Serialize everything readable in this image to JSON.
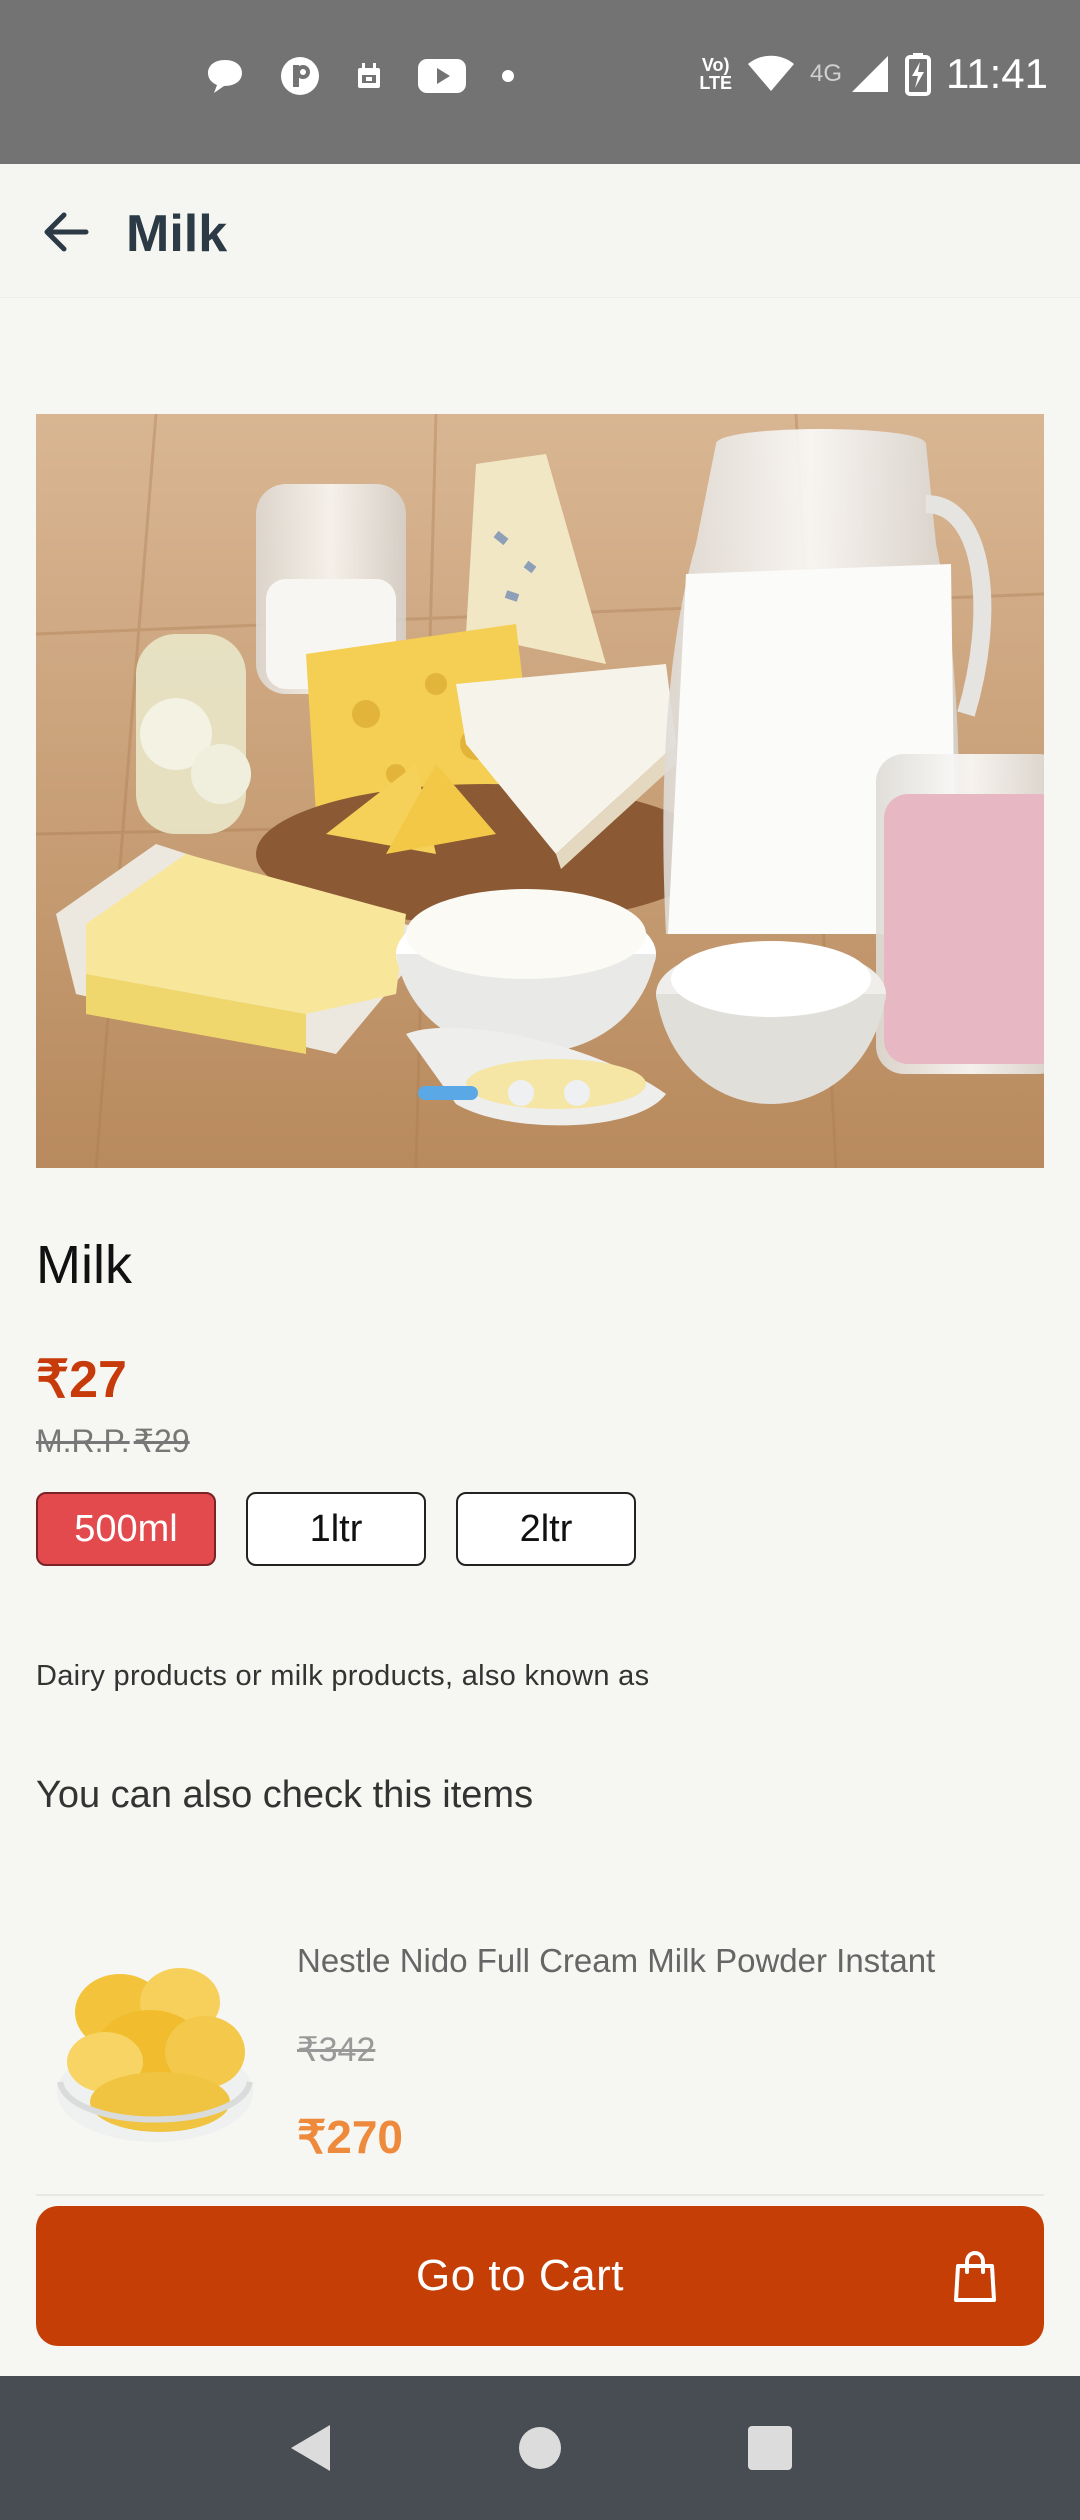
{
  "status_bar": {
    "time": "11:41",
    "network_label_1": "Vo)",
    "network_label_2": "LTE",
    "network_type": "4G",
    "icons": [
      "chat-bubble-icon",
      "circle-p-icon",
      "calendar-icon",
      "youtube-icon",
      "dot-icon",
      "wifi-icon",
      "signal-icon",
      "battery-charging-icon"
    ]
  },
  "app_bar": {
    "title": "Milk",
    "back_icon": "arrow-left-icon"
  },
  "carousel": {
    "slide_count": 3,
    "active_index": 0,
    "colors": {
      "active_dot": "#5aa9e6",
      "inactive_dot": "#eef0f2"
    }
  },
  "product": {
    "name": "Milk",
    "price": "₹27",
    "mrp_label": "M.R.P.",
    "mrp_value": "₹29",
    "description": "Dairy products or milk products, also known as",
    "variants": [
      {
        "label": "500ml",
        "selected": true
      },
      {
        "label": "1ltr",
        "selected": false
      },
      {
        "label": "2ltr",
        "selected": false
      }
    ]
  },
  "suggestions": {
    "heading": "You can also check this items",
    "items": [
      {
        "title": "Nestle Nido Full Cream Milk Powder Instant",
        "mrp": "₹342",
        "price": "₹270"
      }
    ]
  },
  "cart_button": {
    "label": "Go to Cart",
    "icon": "shopping-bag-icon",
    "color": "#c43e06"
  },
  "colors": {
    "price": "#c73a0a",
    "selected_variant": "#e34a4d",
    "suggestion_price": "#ee8a3c"
  }
}
